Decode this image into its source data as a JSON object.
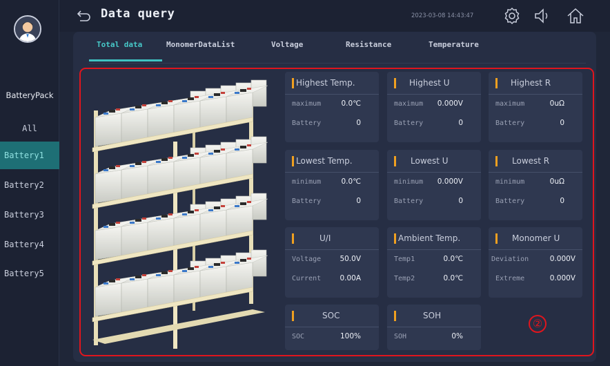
{
  "header": {
    "title": "Data query",
    "timestamp": "2023-03-08 14:43:47",
    "icons": [
      "back-arrow-icon",
      "settings-gear-icon",
      "speaker-icon",
      "home-icon"
    ]
  },
  "sidebar": {
    "group_label": "BatteryPack",
    "items": [
      {
        "label": "All",
        "active": false
      },
      {
        "label": "Battery1",
        "active": true
      },
      {
        "label": "Battery2",
        "active": false
      },
      {
        "label": "Battery3",
        "active": false
      },
      {
        "label": "Battery4",
        "active": false
      },
      {
        "label": "Battery5",
        "active": false
      }
    ]
  },
  "tabs": [
    {
      "label": "Total data",
      "active": true
    },
    {
      "label": "MonomerDataList",
      "active": false
    },
    {
      "label": "Voltage",
      "active": false
    },
    {
      "label": "Resistance",
      "active": false
    },
    {
      "label": "Temperature",
      "active": false
    }
  ],
  "cards": {
    "highest_temp": {
      "title": "Highest Temp.",
      "k1": "maximum",
      "v1": "0.0℃",
      "k2": "Battery",
      "v2": "0"
    },
    "highest_u": {
      "title": "Highest U",
      "k1": "maximum",
      "v1": "0.000V",
      "k2": "Battery",
      "v2": "0"
    },
    "highest_r": {
      "title": "Highest R",
      "k1": "maximum",
      "v1": "0uΩ",
      "k2": "Battery",
      "v2": "0"
    },
    "lowest_temp": {
      "title": "Lowest Temp.",
      "k1": "minimum",
      "v1": "0.0℃",
      "k2": "Battery",
      "v2": "0"
    },
    "lowest_u": {
      "title": "Lowest U",
      "k1": "minimum",
      "v1": "0.000V",
      "k2": "Battery",
      "v2": "0"
    },
    "lowest_r": {
      "title": "Lowest R",
      "k1": "minimum",
      "v1": "0uΩ",
      "k2": "Battery",
      "v2": "0"
    },
    "u_i": {
      "title": "U/I",
      "k1": "Voltage",
      "v1": "50.0V",
      "k2": "Current",
      "v2": "0.00A"
    },
    "ambient": {
      "title": "Ambient Temp.",
      "k1": "Temp1",
      "v1": "0.0℃",
      "k2": "Temp2",
      "v2": "0.0℃"
    },
    "monomer_u": {
      "title": "Monomer U",
      "k1": "Deviation",
      "v1": "0.000V",
      "k2": "Extreme",
      "v2": "0.000V"
    },
    "soc": {
      "title": "SOC",
      "k1": "SOC",
      "v1": "100%"
    },
    "soh": {
      "title": "SOH",
      "k1": "SOH",
      "v1": "0%"
    }
  },
  "annotation_marker": "②",
  "colors": {
    "accent": "#3fc2c2",
    "active_item": "#1e6f75",
    "card_bar": "#f0a020",
    "highlight_frame": "#e0151d"
  }
}
